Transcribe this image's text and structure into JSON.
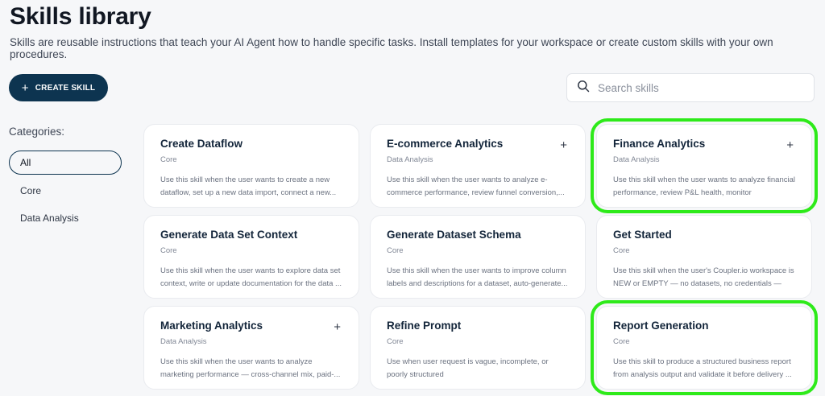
{
  "header": {
    "title": "Skills library",
    "subtitle": "Skills are reusable instructions that teach your AI Agent how to handle specific tasks. Install templates for your workspace or create custom skills with your own procedures."
  },
  "toolbar": {
    "create_label": "CREATE SKILL",
    "create_icon": "plus-icon",
    "search_placeholder": "Search skills",
    "search_icon": "search-icon"
  },
  "sidebar": {
    "label": "Categories:",
    "items": [
      {
        "label": "All",
        "selected": true
      },
      {
        "label": "Core",
        "selected": false
      },
      {
        "label": "Data Analysis",
        "selected": false
      }
    ]
  },
  "cards": [
    {
      "title": "Create Dataflow",
      "category": "Core",
      "description": "Use this skill when the user wants to create a new dataflow, set up a new data import, connect a new...",
      "installable": false
    },
    {
      "title": "E-commerce Analytics",
      "category": "Data Analysis",
      "description": "Use this skill when the user wants to analyze e-commerce performance, review funnel conversion,...",
      "installable": true
    },
    {
      "title": "Finance Analytics",
      "category": "Data Analysis",
      "description": "Use this skill when the user wants to analyze financial performance, review P&L health, monitor MRR/ARR,...",
      "installable": true
    },
    {
      "title": "Generate Data Set Context",
      "category": "Core",
      "description": "Use this skill when the user wants to explore data set context, write or update documentation for the data ...",
      "installable": false
    },
    {
      "title": "Generate Dataset Schema",
      "category": "Core",
      "description": "Use this skill when the user wants to improve column labels and descriptions for a dataset, auto-generate...",
      "installable": false
    },
    {
      "title": "Get Started",
      "category": "Core",
      "description": "Use this skill when the user's Coupler.io workspace is NEW or EMPTY — no datasets, no credentials — and...",
      "installable": false
    },
    {
      "title": "Marketing Analytics",
      "category": "Data Analysis",
      "description": "Use this skill when the user wants to analyze marketing performance — cross-channel mix, paid-...",
      "installable": true
    },
    {
      "title": "Refine Prompt",
      "category": "Core",
      "description": "Use when user request is vague, incomplete, or poorly structured",
      "installable": false
    },
    {
      "title": "Report Generation",
      "category": "Core",
      "description": "Use this skill to produce a structured business report from analysis output and validate it before delivery ...",
      "installable": false
    }
  ],
  "colors": {
    "accent": "#0d3450",
    "highlight": "#2eea1a",
    "background": "#f6f7f9"
  }
}
